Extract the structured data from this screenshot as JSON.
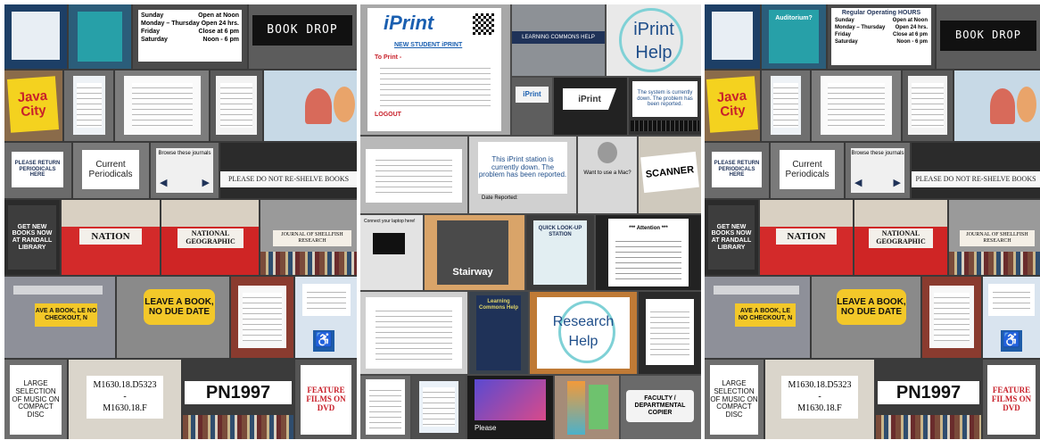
{
  "hours_sign": {
    "rows": [
      {
        "day": "Sunday",
        "time": "Open at Noon"
      },
      {
        "day": "Monday – Thursday",
        "time": "Open 24 hrs."
      },
      {
        "day": "Friday",
        "time": "Close at 6 pm"
      },
      {
        "day": "Saturday",
        "time": "Noon - 6 pm"
      }
    ]
  },
  "hours_heading": "Regular Operating HOURS",
  "auditorium": "Auditorium?",
  "book_drop": "BOOK DROP",
  "java_city": "Java City",
  "return_periodicals": "PLEASE RETURN PERIODICALS HERE",
  "current_periodicals": "Current Periodicals",
  "browse_journals": "Browse these journals",
  "do_not_reshelve": "PLEASE DO NOT RE-SHELVE BOOKS",
  "get_new_books": "GET NEW BOOKS NOW AT RANDALL LIBRARY",
  "nation": "NATION",
  "national_geographic": "NATIONAL GEOGRAPHIC",
  "journal_shellfish": "JOURNAL OF SHELLFISH RESEARCH",
  "leave_a_book": "LEAVE A BOOK, NO DUE DATE",
  "leave_a_book_partial": "AVE A BOOK, LE NO CHECKOUT, N",
  "music_compact_disc": "LARGE SELECTION OF MUSIC ON COMPACT DISC",
  "callno_from": "M1630.18.D5323",
  "callno_sep": "-",
  "callno_to": "M1630.18.F",
  "pn1997": "PN1997",
  "feature_films": "FEATURE FILMS ON DVD",
  "iprint_logo": "iPrint",
  "new_student_iprint": "NEW STUDENT iPRINT",
  "to_print": "To Print -",
  "logout": "LOGOUT",
  "learning_commons_help": "LEARNING COMMONS HELP",
  "iprint": "iPrint",
  "help": "Help",
  "station_down_1": "The system is currently down. The problem has been reported.",
  "station_down_2": "This iPrint station is currently down. The problem has been reported.",
  "date_reported": "Date Reported:",
  "mac_question": "Want to use a Mac?",
  "scanner": "SCANNER",
  "stairway": "Stairway",
  "quick_lookup": "QUICK LOOK-UP STATION",
  "attention": "*** Attention ***",
  "research": "Research",
  "faculty_copier": "FACULTY / DEPARTMENTAL COPIER",
  "connect_laptop": "Connect your laptop here!",
  "please": "Please",
  "learning_commons": "Learning Commons Help",
  "colors": {
    "red": "#c8202a",
    "navy": "#1f3258",
    "java_yellow": "#f4d21f",
    "teal": "#27a0a8"
  },
  "icons": [
    "apple-icon",
    "accessibility-icon",
    "arrow-left-icon",
    "arrow-right-icon",
    "qr-code-icon"
  ]
}
